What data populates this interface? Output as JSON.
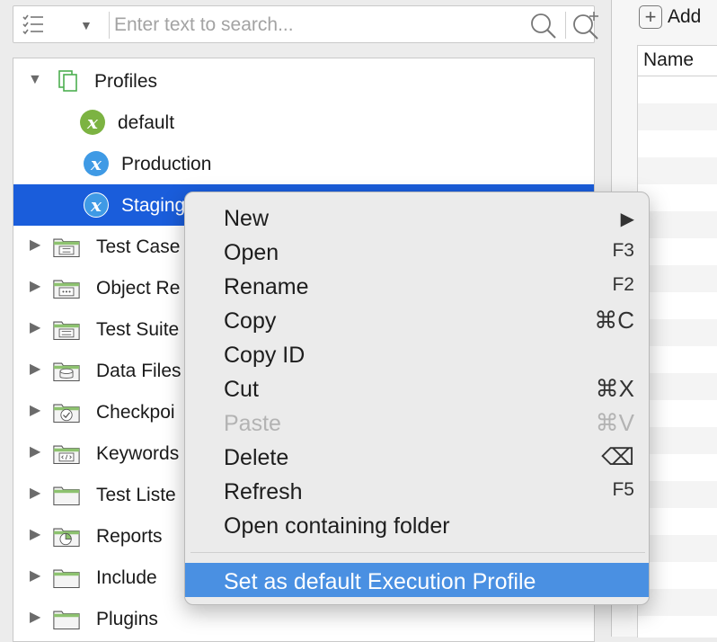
{
  "search": {
    "placeholder": "Enter text to search..."
  },
  "tree": {
    "root": "Profiles",
    "profiles": [
      "default",
      "Production",
      "Staging"
    ],
    "folders": [
      "Test Case",
      "Object Re",
      "Test Suite",
      "Data Files",
      "Checkpoi",
      "Keywords",
      "Test Liste",
      "Reports",
      "Include",
      "Plugins"
    ]
  },
  "right_panel": {
    "add_label": "Add",
    "column_header": "Name"
  },
  "context_menu": {
    "items": [
      {
        "label": "New",
        "shortcut": "▶"
      },
      {
        "label": "Open",
        "shortcut": "F3"
      },
      {
        "label": "Rename",
        "shortcut": "F2"
      },
      {
        "label": "Copy",
        "shortcut": "⌘C"
      },
      {
        "label": "Copy ID",
        "shortcut": ""
      },
      {
        "label": "Cut",
        "shortcut": "⌘X"
      },
      {
        "label": "Paste",
        "shortcut": "⌘V",
        "disabled": true
      },
      {
        "label": "Delete",
        "shortcut": "⌫"
      },
      {
        "label": "Refresh",
        "shortcut": "F5"
      },
      {
        "label": "Open containing folder",
        "shortcut": ""
      }
    ],
    "highlighted": "Set as default Execution Profile"
  },
  "colors": {
    "selection": "#1a5ddb",
    "menu_highlight": "#4a90e2",
    "profile_default": "#7cb342",
    "profile_other": "#3f9ae5",
    "folder_green": "#8dc26f"
  }
}
